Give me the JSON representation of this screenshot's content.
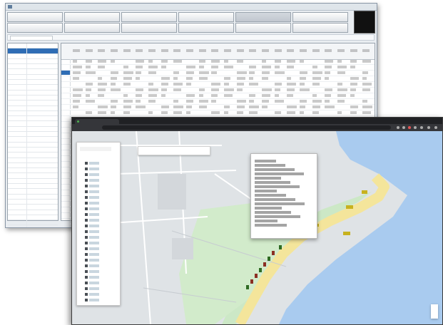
{
  "app": {
    "title": "",
    "toolbar_row1": [
      "",
      "",
      "",
      "",
      "",
      ""
    ],
    "toolbar_row2": [
      "",
      "",
      "",
      "",
      "",
      ""
    ],
    "active_toolbar_index": 4,
    "logo_text": "",
    "path_field": "",
    "status": "",
    "left_panel": {
      "rows": 40,
      "selected_row": 1
    },
    "grid": {
      "rows": 33,
      "selected_row": 2,
      "columns": 24
    }
  },
  "browser": {
    "tab_title": "",
    "tab_close": "",
    "new_tab": "",
    "url": "",
    "window_controls": [
      "",
      "",
      ""
    ],
    "nav": [
      "",
      "",
      ""
    ]
  },
  "map": {
    "side_panel_title": "",
    "side_panel_items": 25,
    "toolbar_icons": [
      "",
      "",
      "",
      "",
      "",
      ""
    ],
    "popup_line_count": 16,
    "popup_actions": [
      "",
      "",
      "",
      ""
    ],
    "zoom": [
      "",
      ""
    ],
    "marker_glyph": ""
  },
  "colors": {
    "selection": "#2f6db5",
    "logo_bg": "#111111",
    "logo_text": "#f2d12a",
    "map_water": "#a9cbef",
    "map_land": "#dfe3e6",
    "map_park": "#cce8c6",
    "map_road": "#f4e59b",
    "browser_chrome": "#202124"
  }
}
